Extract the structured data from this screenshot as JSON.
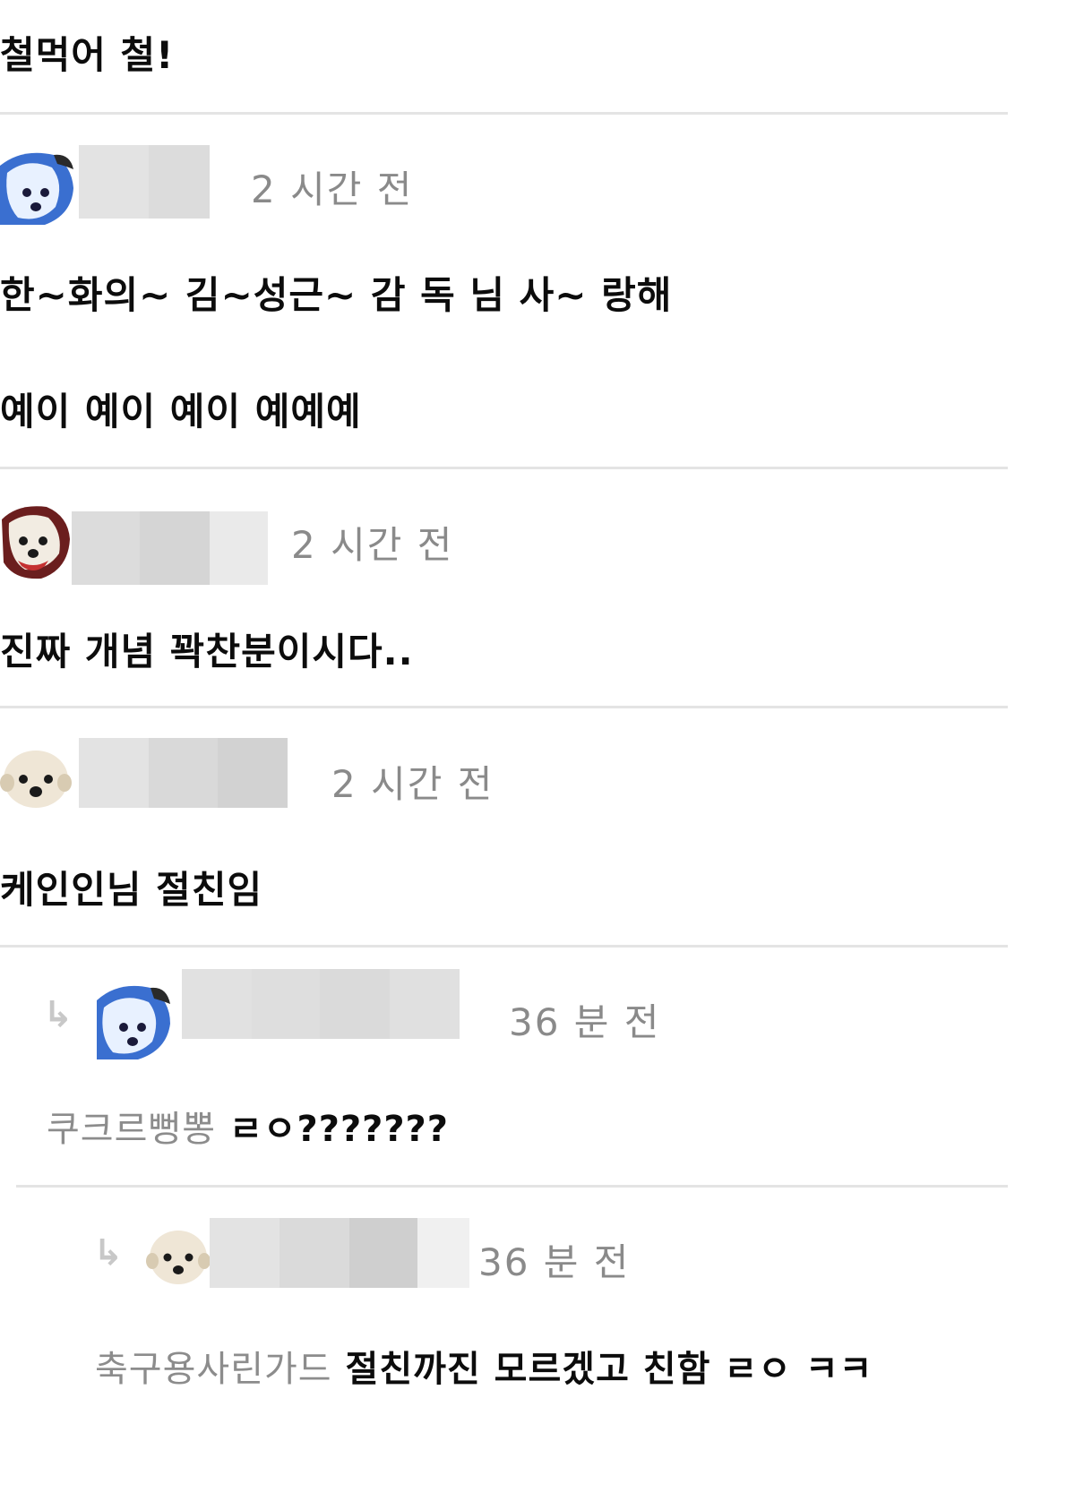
{
  "comments": [
    {
      "body": "철먹어 철!"
    },
    {
      "time": "2 시간 전",
      "lines": [
        "한~화의~ 김~성근~ 감 독 님 사~ 랑해",
        "예이 예이 예이 예예예"
      ]
    },
    {
      "time": "2 시간 전",
      "body": "진짜 개념 꽉찬분이시다.."
    },
    {
      "time": "2 시간 전",
      "body": "케인인님 절친임"
    }
  ],
  "replies": [
    {
      "time": "36 분 전",
      "mention": "쿠크르뻥뽕",
      "body": "ㄹㅇ???????"
    },
    {
      "time": "36 분 전",
      "mention": "축구용사린가드",
      "body": "절친까진 모르겠고 친함 ㄹㅇ ㅋㅋ"
    }
  ],
  "icons": {
    "reply": "reply-arrow-icon",
    "avatar_blue": "blue-dog-avatar",
    "avatar_dog": "white-dog-avatar"
  },
  "colors": {
    "time": "#8a8a8a",
    "mention": "#8c8c8c",
    "divider": "#e4e4e4"
  }
}
